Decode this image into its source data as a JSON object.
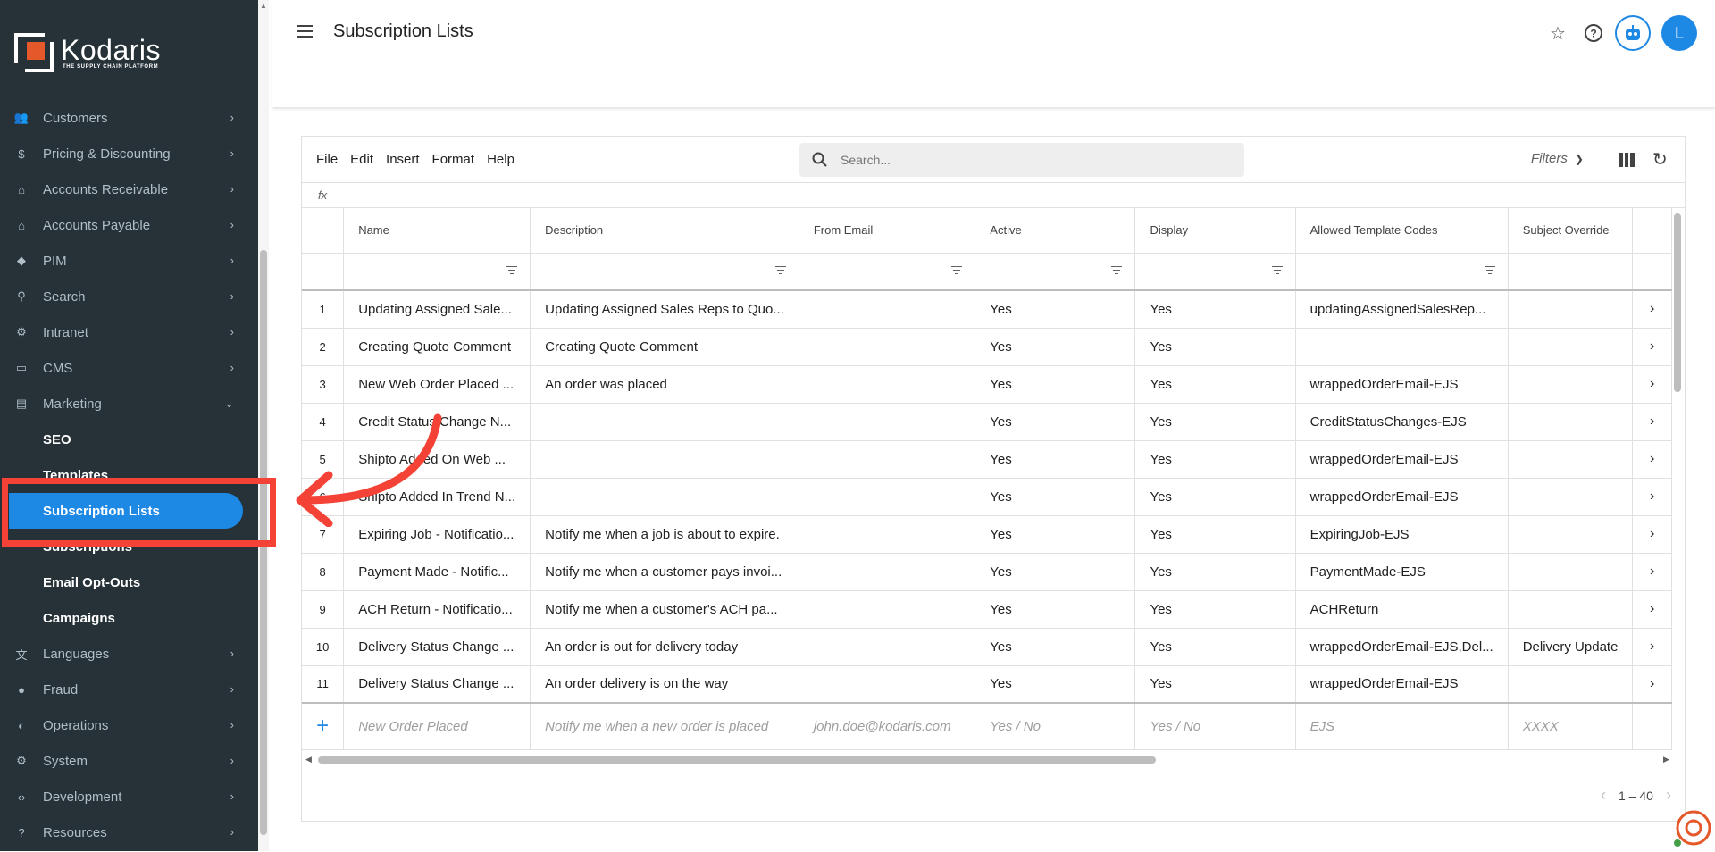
{
  "app": {
    "name": "Kodaris",
    "tagline": "THE SUPPLY CHAIN PLATFORM"
  },
  "sidebar": {
    "items": [
      {
        "label": "Customers",
        "icon": "people-icon"
      },
      {
        "label": "Pricing & Discounting",
        "icon": "dollar-icon"
      },
      {
        "label": "Accounts Receivable",
        "icon": "bank-icon"
      },
      {
        "label": "Accounts Payable",
        "icon": "bank-icon"
      },
      {
        "label": "PIM",
        "icon": "tag-icon"
      },
      {
        "label": "Search",
        "icon": "search-icon"
      },
      {
        "label": "Intranet",
        "icon": "intranet-icon"
      },
      {
        "label": "CMS",
        "icon": "cms-icon"
      },
      {
        "label": "Marketing",
        "icon": "marketing-icon",
        "expanded": true
      }
    ],
    "marketing_sub": [
      {
        "label": "SEO"
      },
      {
        "label": "Templates"
      },
      {
        "label": "Subscription Lists",
        "active": true
      },
      {
        "label": "Subscriptions"
      },
      {
        "label": "Email Opt-Outs"
      },
      {
        "label": "Campaigns"
      }
    ],
    "items_after": [
      {
        "label": "Languages",
        "icon": "translate-icon"
      },
      {
        "label": "Fraud",
        "icon": "alert-icon"
      },
      {
        "label": "Operations",
        "icon": "operations-icon"
      },
      {
        "label": "System",
        "icon": "gear-icon"
      },
      {
        "label": "Development",
        "icon": "code-icon"
      },
      {
        "label": "Resources",
        "icon": "help-icon"
      }
    ]
  },
  "header": {
    "title": "Subscription Lists",
    "avatar_letter": "L"
  },
  "toolbar": {
    "menu": [
      "File",
      "Edit",
      "Insert",
      "Format",
      "Help"
    ],
    "search_placeholder": "Search...",
    "filters_label": "Filters",
    "fx_label": "fx"
  },
  "grid": {
    "columns": [
      "Name",
      "Description",
      "From Email",
      "Active",
      "Display",
      "Allowed Template Codes",
      "Subject Override"
    ],
    "rows": [
      [
        "1",
        "Updating Assigned Sale...",
        "Updating Assigned Sales Reps to Quo...",
        "",
        "Yes",
        "Yes",
        "updatingAssignedSalesRep...",
        ""
      ],
      [
        "2",
        "Creating Quote Comment",
        "Creating Quote Comment",
        "",
        "Yes",
        "Yes",
        "",
        ""
      ],
      [
        "3",
        "New Web Order Placed ...",
        "An order was placed",
        "",
        "Yes",
        "Yes",
        "wrappedOrderEmail-EJS",
        ""
      ],
      [
        "4",
        "Credit Status Change N...",
        "",
        "",
        "Yes",
        "Yes",
        "CreditStatusChanges-EJS",
        ""
      ],
      [
        "5",
        "Shipto Added On Web ...",
        "",
        "",
        "Yes",
        "Yes",
        "wrappedOrderEmail-EJS",
        ""
      ],
      [
        "6",
        "Shipto Added In Trend N...",
        "",
        "",
        "Yes",
        "Yes",
        "wrappedOrderEmail-EJS",
        ""
      ],
      [
        "7",
        "Expiring Job - Notificatio...",
        "Notify me when a job is about to expire.",
        "",
        "Yes",
        "Yes",
        "ExpiringJob-EJS",
        ""
      ],
      [
        "8",
        "Payment Made - Notific...",
        "Notify me when a customer pays invoi...",
        "",
        "Yes",
        "Yes",
        "PaymentMade-EJS",
        ""
      ],
      [
        "9",
        "ACH Return - Notificatio...",
        "Notify me when a customer's ACH pa...",
        "",
        "Yes",
        "Yes",
        "ACHReturn",
        ""
      ],
      [
        "10",
        "Delivery Status Change ...",
        "An order is out for delivery today",
        "",
        "Yes",
        "Yes",
        "wrappedOrderEmail-EJS,Del...",
        "Delivery Update"
      ],
      [
        "11",
        "Delivery Status Change ...",
        "An order delivery is on the way",
        "",
        "Yes",
        "Yes",
        "wrappedOrderEmail-EJS",
        ""
      ]
    ],
    "new_row": {
      "name": "New Order Placed",
      "description": "Notify me when a new order is placed",
      "from_email": "john.doe@kodaris.com",
      "active": "Yes / No",
      "display": "Yes / No",
      "template_codes": "EJS",
      "subject": "XXXX"
    },
    "pager": "1 – 40"
  },
  "colors": {
    "sidebar": "#263238",
    "accent": "#1e88e5",
    "highlight": "#f44336"
  }
}
